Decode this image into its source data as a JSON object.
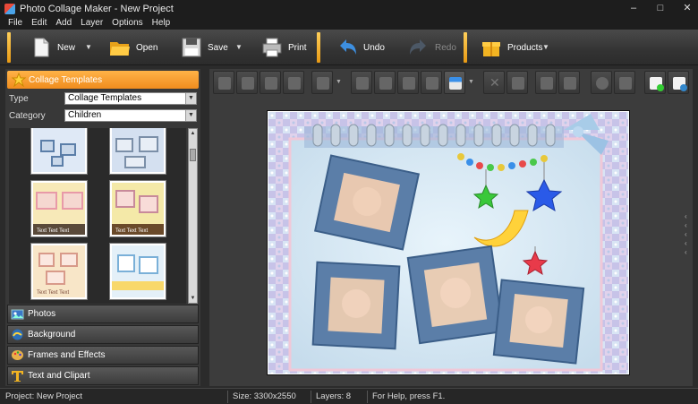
{
  "window": {
    "title": "Photo Collage Maker - New Project",
    "controls": [
      "–",
      "□",
      "✕"
    ]
  },
  "menu": [
    "File",
    "Edit",
    "Add",
    "Layer",
    "Options",
    "Help"
  ],
  "toolbar": {
    "new_label": "New",
    "open_label": "Open",
    "save_label": "Save",
    "print_label": "Print",
    "undo_label": "Undo",
    "redo_label": "Redo",
    "products_label": "Products"
  },
  "left_panel": {
    "header": "Collage Templates",
    "type_label": "Type",
    "type_value": "Collage Templates",
    "category_label": "Category",
    "category_value": "Children",
    "thumb_caption": "Text Text Text",
    "sections": [
      "Photos",
      "Background",
      "Frames and Effects",
      "Text and Clipart"
    ]
  },
  "status": {
    "project": "Project: New Project",
    "size": "Size: 3300x2550",
    "layers": "Layers: 8",
    "help": "For Help, press F1."
  },
  "colors": {
    "accent": "#f5a623",
    "panel": "#383838",
    "background": "#2b2b2b"
  }
}
